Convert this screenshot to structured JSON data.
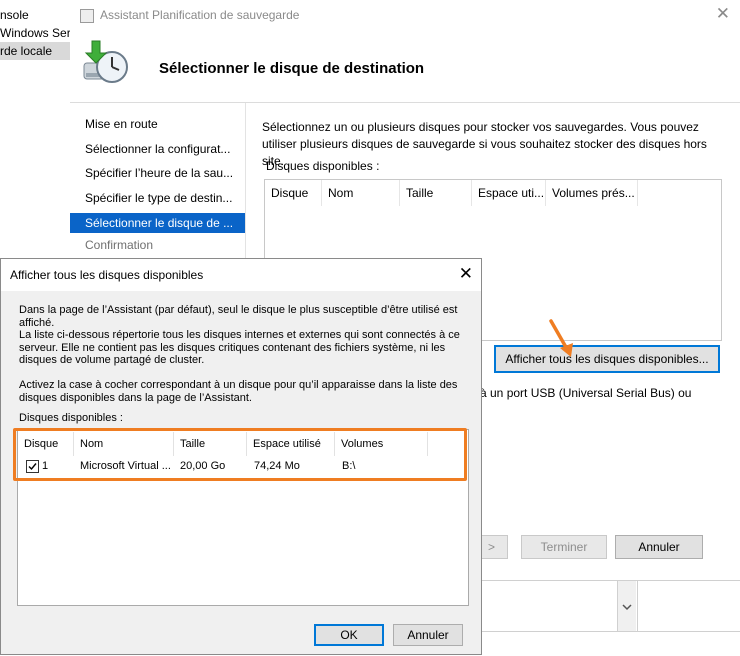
{
  "console": {
    "items": [
      "nsole",
      "Windows Ser",
      "rde locale"
    ]
  },
  "wizard": {
    "title": "Assistant Planification de sauvegarde",
    "header": "Sélectionner le disque de destination",
    "steps": [
      {
        "label": "Mise en route",
        "state": "normal"
      },
      {
        "label": "Sélectionner la configurat...",
        "state": "normal"
      },
      {
        "label": "Spécifier l’heure de la sau...",
        "state": "normal"
      },
      {
        "label": "Spécifier le type de destin...",
        "state": "normal"
      },
      {
        "label": "Sélectionner le disque de ...",
        "state": "active"
      },
      {
        "label": "Confirmation",
        "state": "dim"
      }
    ],
    "description": "Sélectionnez un ou plusieurs disques pour stocker vos sauvegardes. Vous pouvez utiliser plusieurs disques de sauvegarde si vous souhaitez stocker des disques hors site.",
    "available_label": "Disques disponibles :",
    "columns": [
      "Disque",
      "Nom",
      "Taille",
      "Espace uti...",
      "Volumes prés..."
    ],
    "show_all_button": "Afficher tous les disques disponibles...",
    "usb_text": "à un port USB (Universal Serial Bus) ou",
    "buttons": {
      "next": ">",
      "finish": "Terminer",
      "cancel": "Annuler"
    }
  },
  "dialog": {
    "title": "Afficher tous les disques disponibles",
    "para1": "Dans la page de l’Assistant (par défaut), seul le disque le plus susceptible d’être utilisé est affiché.",
    "para2": "La liste ci-dessous répertorie tous les disques internes et externes qui sont connectés à ce serveur. Elle ne contient pas les disques critiques contenant des fichiers système, ni les disques de volume partagé de cluster.",
    "para3": "Activez la case à cocher correspondant à un disque pour qu’il apparaisse dans la liste des disques disponibles dans la page de l’Assistant.",
    "list_label": "Disques disponibles :",
    "columns": [
      "Disque",
      "Nom",
      "Taille",
      "Espace utilisé",
      "Volumes"
    ],
    "row": {
      "checked": true,
      "disk": "1",
      "name": "Microsoft Virtual ...",
      "size": "20,00 Go",
      "used": "74,24 Mo",
      "volumes": "B:\\"
    },
    "ok": "OK",
    "cancel": "Annuler"
  },
  "colors": {
    "accent": "#0a64c8",
    "highlight": "#ef7d22"
  }
}
